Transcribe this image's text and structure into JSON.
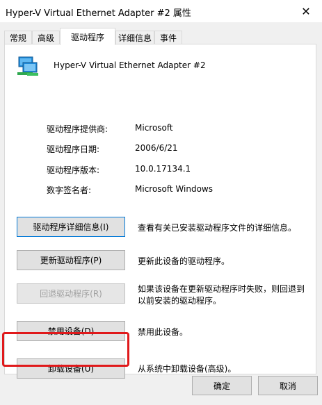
{
  "window": {
    "title": "Hyper-V Virtual Ethernet Adapter #2 属性",
    "close_glyph": "✕"
  },
  "tabs": [
    {
      "label": "常规",
      "active": false
    },
    {
      "label": "高级",
      "active": false
    },
    {
      "label": "驱动程序",
      "active": true
    },
    {
      "label": "详细信息",
      "active": false
    },
    {
      "label": "事件",
      "active": false
    }
  ],
  "device": {
    "name": "Hyper-V Virtual Ethernet Adapter #2",
    "icon": "network-adapter-icon"
  },
  "driver_info": [
    {
      "label": "驱动程序提供商:",
      "value": "Microsoft"
    },
    {
      "label": "驱动程序日期:",
      "value": "2006/6/21"
    },
    {
      "label": "驱动程序版本:",
      "value": "10.0.17134.1"
    },
    {
      "label": "数字签名者:",
      "value": "Microsoft Windows"
    }
  ],
  "actions": [
    {
      "label": "驱动程序详细信息(I)",
      "desc": "查看有关已安装驱动程序文件的详细信息。",
      "enabled": true,
      "focused": true
    },
    {
      "label": "更新驱动程序(P)",
      "desc": "更新此设备的驱动程序。",
      "enabled": true,
      "focused": false
    },
    {
      "label": "回退驱动程序(R)",
      "desc": "如果该设备在更新驱动程序时失败，则回退到以前安装的驱动程序。",
      "enabled": false,
      "focused": false
    },
    {
      "label": "禁用设备(D)",
      "desc": "禁用此设备。",
      "enabled": true,
      "focused": false
    },
    {
      "label": "卸载设备(U)",
      "desc": "从系统中卸载设备(高级)。",
      "enabled": true,
      "focused": false,
      "highlighted": true
    }
  ],
  "dialog_buttons": {
    "ok": "确定",
    "cancel": "取消"
  },
  "colors": {
    "highlight_box": "#e0191b",
    "focus_border": "#0078d7"
  }
}
